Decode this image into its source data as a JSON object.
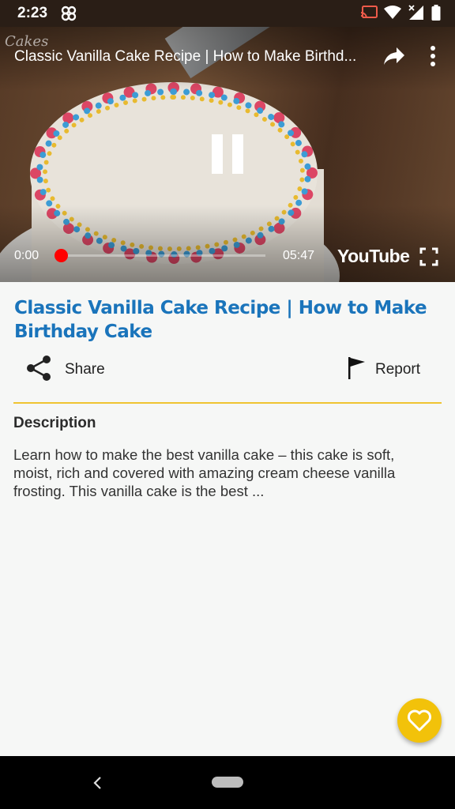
{
  "status_bar": {
    "time": "2:23"
  },
  "video": {
    "title": "Classic Vanilla Cake Recipe | How to Make Birthd...",
    "current_time": "0:00",
    "duration": "05:47",
    "progress_fraction": 0.0,
    "brand": "YouTube",
    "channel_logo_text": "Cakes"
  },
  "content": {
    "title": "Classic Vanilla Cake Recipe | How to Make Birthday Cake",
    "share_label": "Share",
    "report_label": "Report",
    "description_heading": "Description",
    "description": "Learn how to make the best vanilla cake – this cake is soft, moist, rich and covered with amazing cream cheese vanilla frosting. This vanilla cake is the best ..."
  },
  "colors": {
    "title": "#1a74bb",
    "accent": "#f2c20a",
    "progress": "#ff0000"
  },
  "icons": {
    "notification": "pinwheel-icon",
    "cast": "cast-icon",
    "wifi": "wifi-icon",
    "signal": "signal-icon",
    "battery": "battery-icon",
    "share": "share-icon",
    "more": "more-vert-icon",
    "pause": "pause-icon",
    "fullscreen": "fullscreen-icon",
    "report": "flag-icon",
    "favorite": "heart-outline-icon",
    "back": "back-icon",
    "home": "home-pill"
  }
}
